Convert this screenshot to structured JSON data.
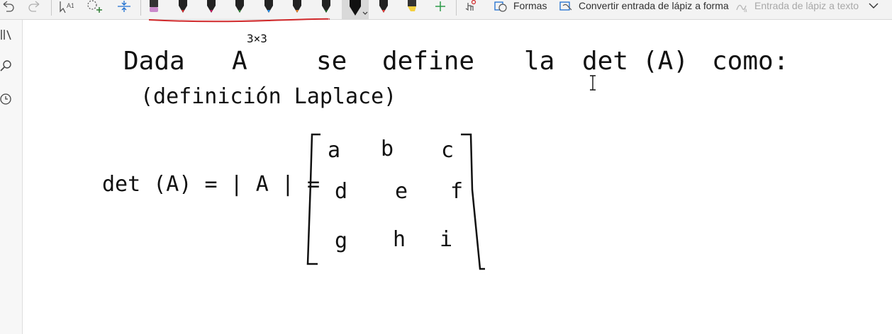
{
  "toolbar": {
    "shapes_label": "Formas",
    "ink_to_shape_label": "Convertir entrada de lápiz a forma",
    "ink_to_text_label": "Entrada de lápiz a texto",
    "pens": [
      {
        "name": "pink-highlighter",
        "color": "#c98acb"
      },
      {
        "name": "red-pen",
        "color": "#d0282a"
      },
      {
        "name": "magenta-pen",
        "color": "#c2185b"
      },
      {
        "name": "green-pen",
        "color": "#2e7d32"
      },
      {
        "name": "blue-pen",
        "color": "#1e88e5"
      },
      {
        "name": "orange-pen",
        "color": "#e67e22"
      },
      {
        "name": "dark-green-pen",
        "color": "#1b5e20"
      },
      {
        "name": "black-pen-selected",
        "color": "#111111"
      },
      {
        "name": "red-pen-2",
        "color": "#e53935"
      },
      {
        "name": "yellow-highlighter",
        "color": "#f4d03f"
      }
    ]
  },
  "note": {
    "line1_words": [
      "Dada",
      "A",
      "se",
      "define",
      "la",
      "det",
      "(A)",
      "como:"
    ],
    "exponent": "3×3",
    "line2": "(definición Laplace)",
    "lhs": "det (A) = | A | =",
    "matrix": [
      [
        "a",
        "b",
        "c"
      ],
      [
        "d",
        "e",
        "f"
      ],
      [
        "g",
        "h",
        "i"
      ]
    ]
  }
}
